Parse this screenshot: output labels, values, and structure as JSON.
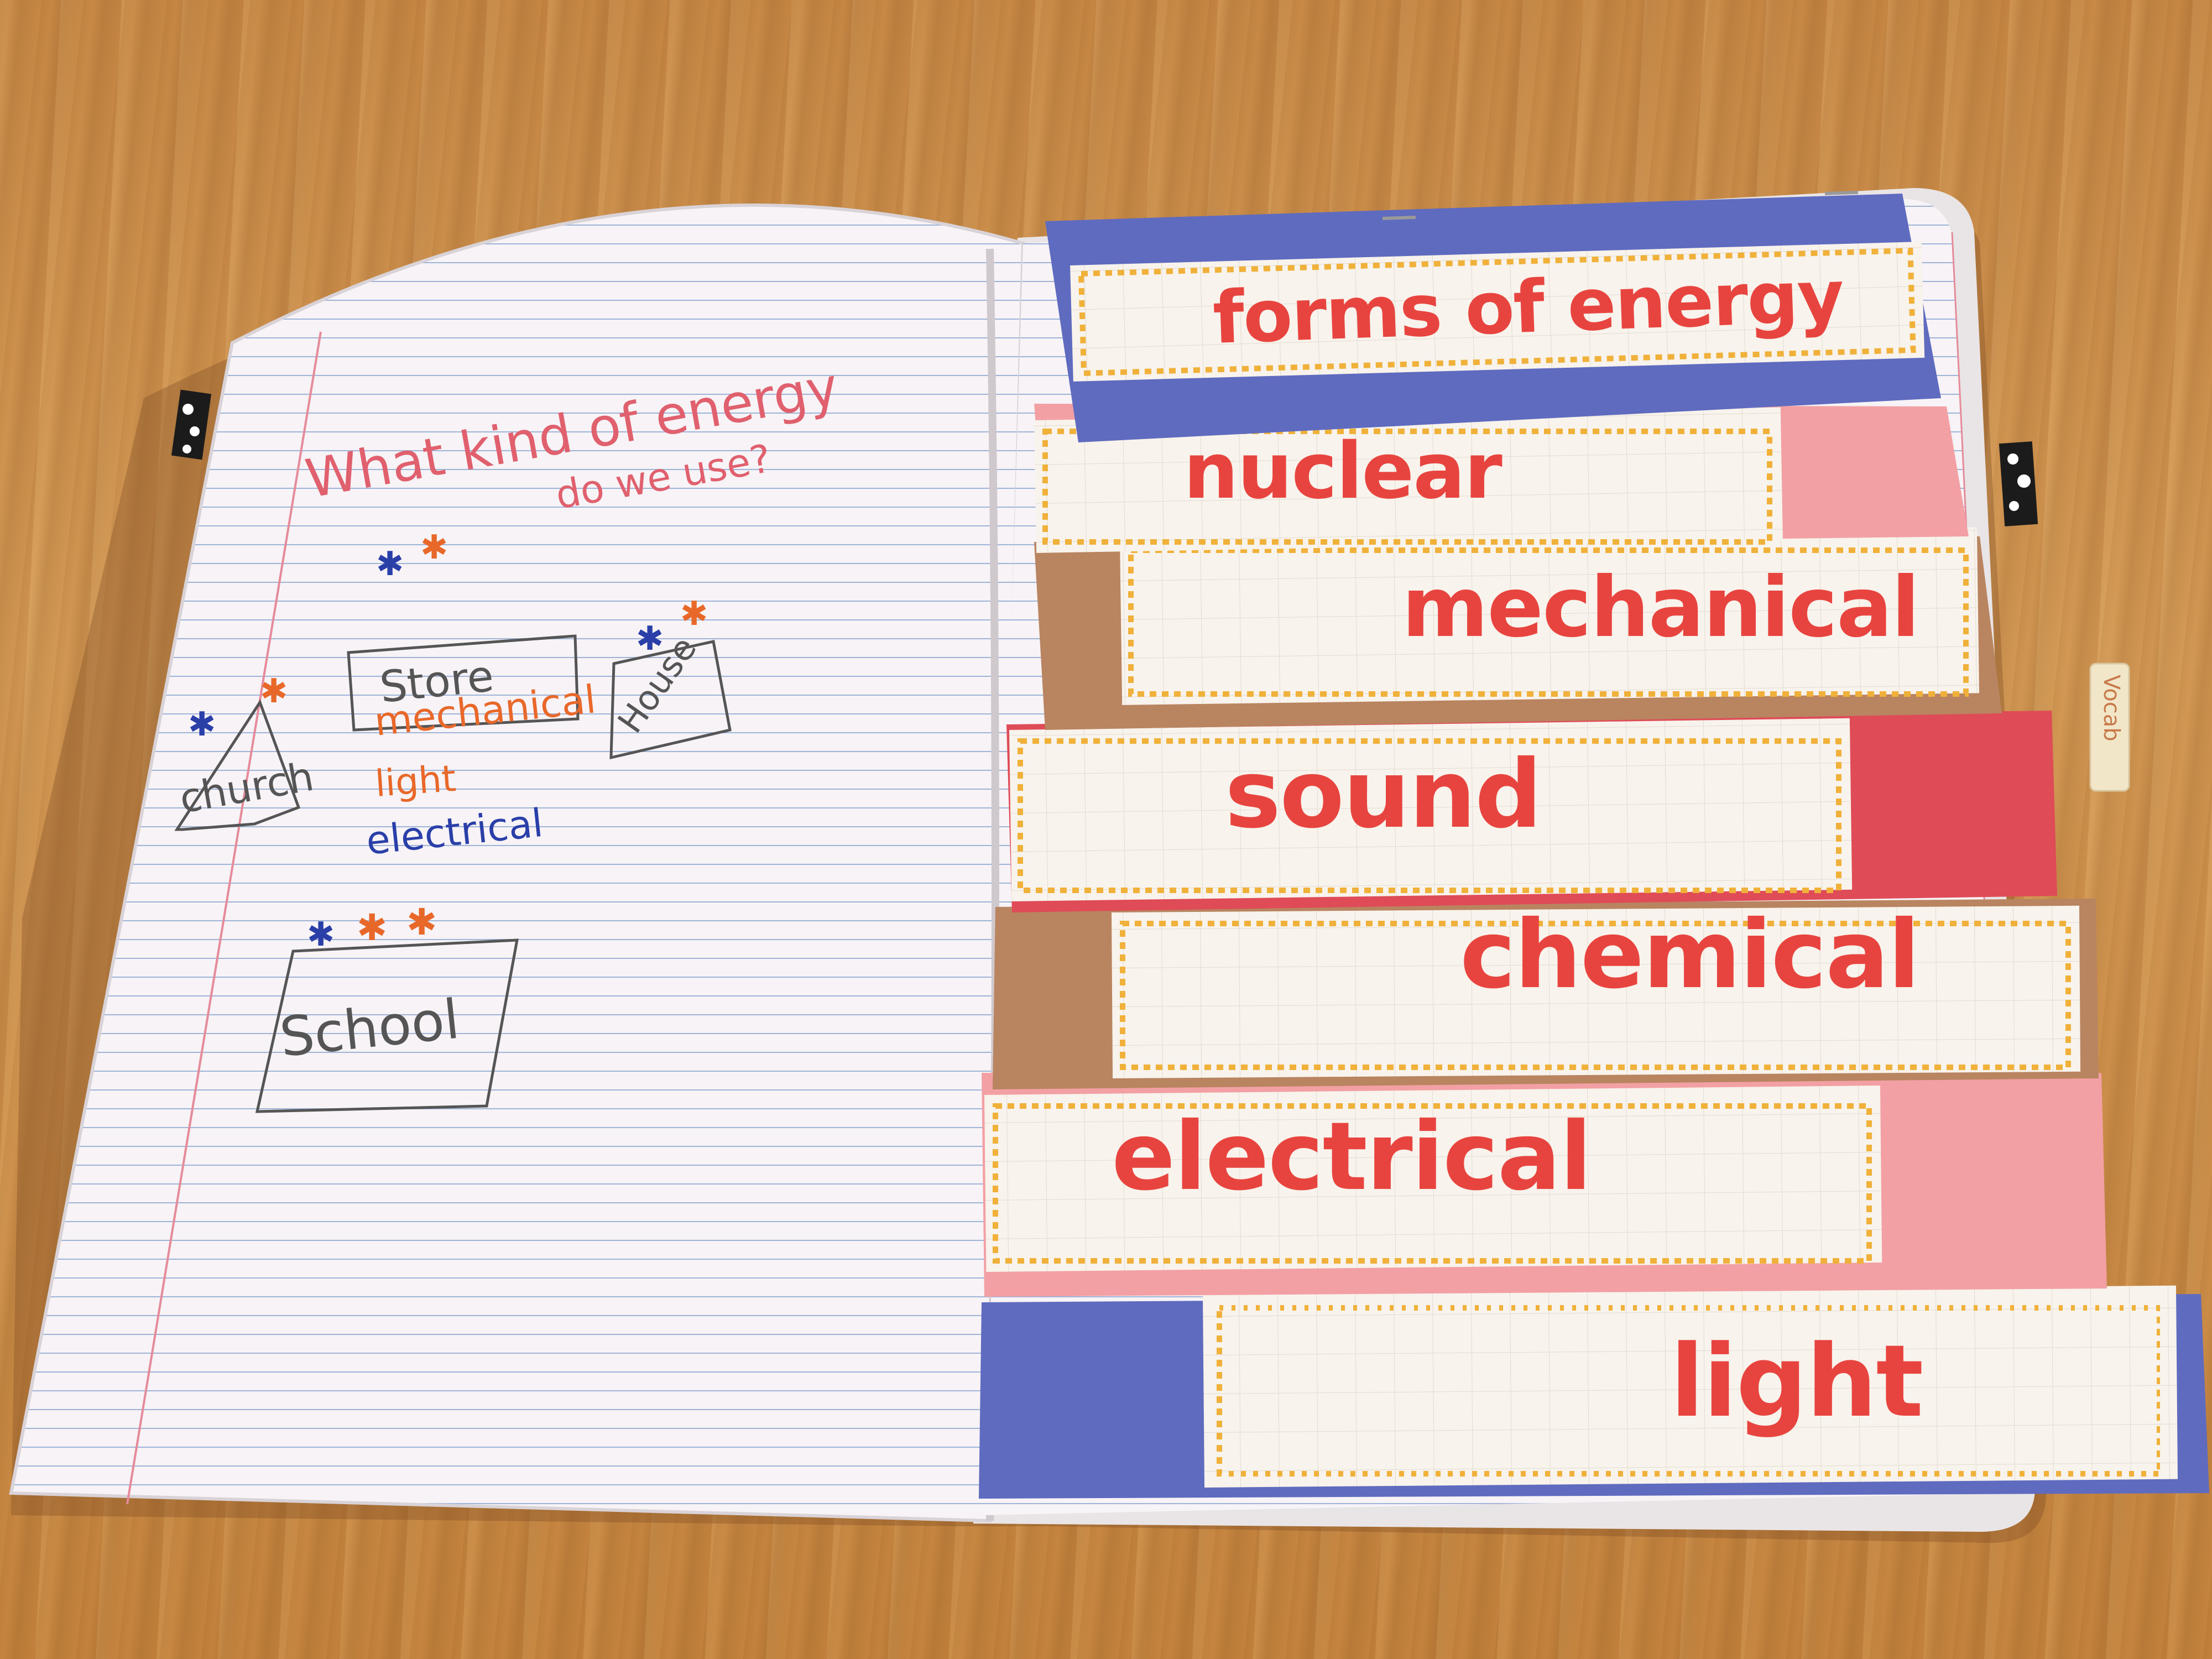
{
  "left_page": {
    "question_line1": "What kind of energy",
    "question_line2": "do we use?",
    "places": [
      "Store",
      "House",
      "church",
      "School"
    ],
    "energy_words": [
      "mechanical",
      "light",
      "electrical"
    ]
  },
  "right_page": {
    "header": "forms of energy",
    "tabs": [
      "nuclear",
      "mechanical",
      "sound",
      "chemical",
      "electrical",
      "light"
    ],
    "side_tab": "Vocab"
  },
  "colors": {
    "wood": "#cc8e4b",
    "paper": "#f7f3f6",
    "rule_blue": "#9fb4d8",
    "margin_red": "#e58b9a",
    "purple_paper": "#5f6bbf",
    "pink_paper": "#f2a0a4",
    "brown_paper": "#b98460",
    "red_paper": "#df4b57",
    "label_red": "#e8443f",
    "ink_blue": "#2a3fa8",
    "ink_orange": "#e8682a",
    "pencil": "#555555"
  }
}
